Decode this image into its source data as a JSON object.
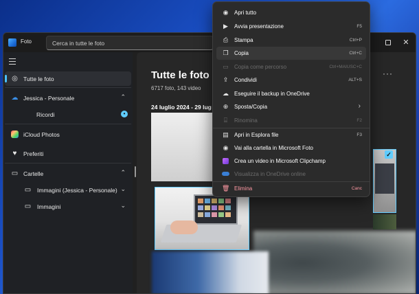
{
  "app": {
    "title": "Foto",
    "search_placeholder": "Cerca in tutte le foto"
  },
  "sidebar": {
    "items": [
      {
        "label": "Tutte le foto",
        "icon": "photos-icon"
      },
      {
        "label": "Jessica - Personale",
        "icon": "onedrive-cloud-icon"
      },
      {
        "label": "Ricordi",
        "icon": "none"
      },
      {
        "label": "iCloud Photos",
        "icon": "icloud-icon"
      },
      {
        "label": "Preferiti",
        "icon": "heart-icon"
      },
      {
        "label": "Cartelle",
        "icon": "folder-icon"
      },
      {
        "label": "Immagini (Jessica - Personale)",
        "icon": "folder-icon"
      },
      {
        "label": "Immagini",
        "icon": "folder-icon"
      }
    ]
  },
  "main": {
    "title": "Tutte le foto",
    "subtitle": "6717 foto, 143 video",
    "date_range": "24 luglio 2024 - 29 lug"
  },
  "context_menu": {
    "items": [
      {
        "label": "Apri tutto",
        "shortcut": "",
        "icon": "eye-icon"
      },
      {
        "label": "Avvia presentazione",
        "shortcut": "F5",
        "icon": "slideshow-icon"
      },
      {
        "label": "Stampa",
        "shortcut": "Ctrl+P",
        "icon": "printer-icon"
      },
      {
        "label": "Copia",
        "shortcut": "Ctrl+C",
        "icon": "copy-icon"
      },
      {
        "label": "Copia come percorso",
        "shortcut": "Ctrl+MAIUSC+C",
        "icon": "copy-path-icon"
      },
      {
        "label": "Condividi",
        "shortcut": "ALT+S",
        "icon": "share-icon"
      },
      {
        "label": "Eseguire il backup in OneDrive",
        "shortcut": "",
        "icon": "backup-icon"
      },
      {
        "label": "Sposta/Copia",
        "shortcut": "",
        "icon": "move-icon"
      },
      {
        "label": "Rinomina",
        "shortcut": "F2",
        "icon": "rename-icon"
      },
      {
        "label": "Apri in Esplora file",
        "shortcut": "F3",
        "icon": "explorer-icon"
      },
      {
        "label": "Vai alla cartella in Microsoft Foto",
        "shortcut": "",
        "icon": "eye-icon"
      },
      {
        "label": "Crea un video in Microsoft Clipchamp",
        "shortcut": "",
        "icon": "clipchamp-icon"
      },
      {
        "label": "Visualizza in OneDrive online",
        "shortcut": "",
        "icon": "onedrive-icon"
      },
      {
        "label": "Elimina",
        "shortcut": "Canc",
        "icon": "trash-icon"
      }
    ]
  },
  "colors": {
    "accent": "#60cdff",
    "danger": "#ff99a4",
    "window_bg": "#202020",
    "menu_bg": "#2b2b2b"
  }
}
